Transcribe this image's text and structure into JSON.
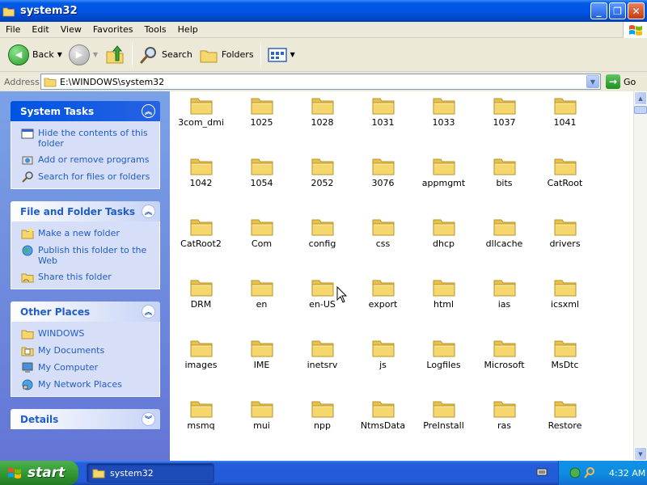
{
  "window": {
    "title": "system32"
  },
  "menu": [
    "File",
    "Edit",
    "View",
    "Favorites",
    "Tools",
    "Help"
  ],
  "toolbar": {
    "back_label": "Back",
    "search_label": "Search",
    "folders_label": "Folders"
  },
  "address": {
    "label": "Address",
    "value": "E:\\WINDOWS\\system32",
    "go_label": "Go"
  },
  "taskpane": {
    "system_tasks": {
      "title": "System Tasks",
      "items": [
        "Hide the contents of this folder",
        "Add or remove programs",
        "Search for files or folders"
      ]
    },
    "file_folder_tasks": {
      "title": "File and Folder Tasks",
      "items": [
        "Make a new folder",
        "Publish this folder to the Web",
        "Share this folder"
      ]
    },
    "other_places": {
      "title": "Other Places",
      "items": [
        "WINDOWS",
        "My Documents",
        "My Computer",
        "My Network Places"
      ]
    },
    "details": {
      "title": "Details"
    }
  },
  "folders": [
    "3com_dmi",
    "1025",
    "1028",
    "1031",
    "1033",
    "1037",
    "1041",
    "1042",
    "1054",
    "2052",
    "3076",
    "appmgmt",
    "bits",
    "CatRoot",
    "CatRoot2",
    "Com",
    "config",
    "css",
    "dhcp",
    "dllcache",
    "drivers",
    "DRM",
    "en",
    "en-US",
    "export",
    "html",
    "ias",
    "icsxml",
    "images",
    "IME",
    "inetsrv",
    "js",
    "Logfiles",
    "Microsoft",
    "MsDtc",
    "msmq",
    "mui",
    "npp",
    "NtmsData",
    "PreInstall",
    "ras",
    "Restore"
  ],
  "taskbar": {
    "start_label": "start",
    "window_button": "system32",
    "clock": "4:32 AM"
  },
  "colors": {
    "title_blue": "#0054e3",
    "task_link": "#215dc6",
    "folder_yellow": "#f5d76e"
  }
}
